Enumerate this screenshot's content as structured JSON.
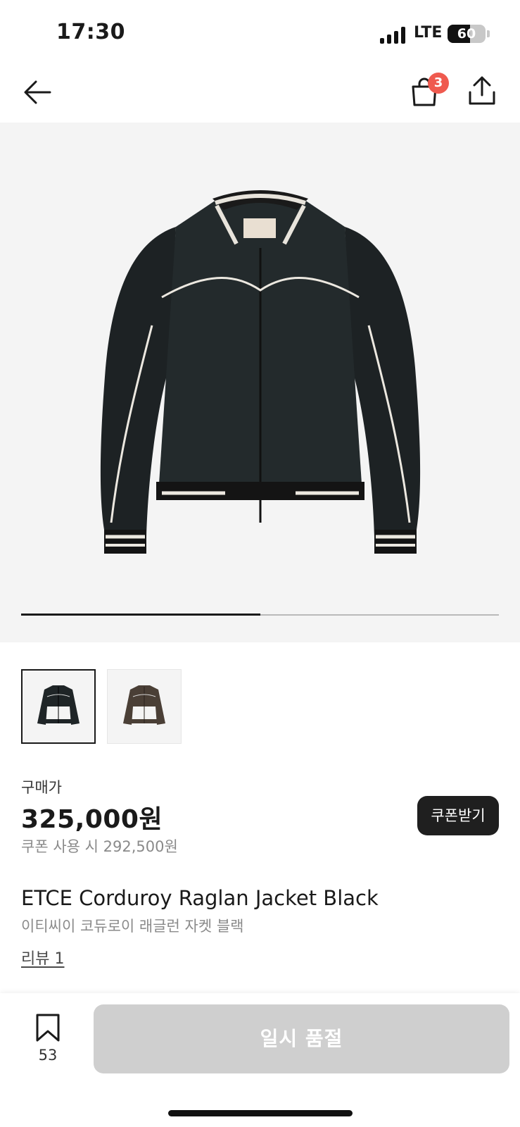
{
  "status_bar": {
    "time": "17:30",
    "network": "LTE",
    "battery_level": 60,
    "battery_text": "60"
  },
  "nav": {
    "back_icon": "arrow-left-icon",
    "cart_icon": "shopping-bag-icon",
    "cart_badge": "3",
    "share_icon": "share-icon",
    "badge_color": "#ef5a4f"
  },
  "gallery": {
    "image_count": 2,
    "current_index": 1,
    "images": [
      {
        "description_icon": "black-corduroy-jacket"
      },
      {
        "description_icon": "brown-corduroy-jacket"
      }
    ]
  },
  "price": {
    "label": "구매가",
    "value": "325,000원",
    "coupon_text": "쿠폰 사용 시 292,500원",
    "coupon_button": "쿠폰받기"
  },
  "product": {
    "name_en": "ETCE Corduroy Raglan Jacket Black",
    "name_ko": "이티씨이 코듀로이 래글런 자켓 블랙",
    "review_link": "리뷰 1"
  },
  "bottom_bar": {
    "bookmark_icon": "bookmark-icon",
    "bookmark_count": "53",
    "action_button": "일시 품절",
    "action_color": "#cfcfcf"
  }
}
